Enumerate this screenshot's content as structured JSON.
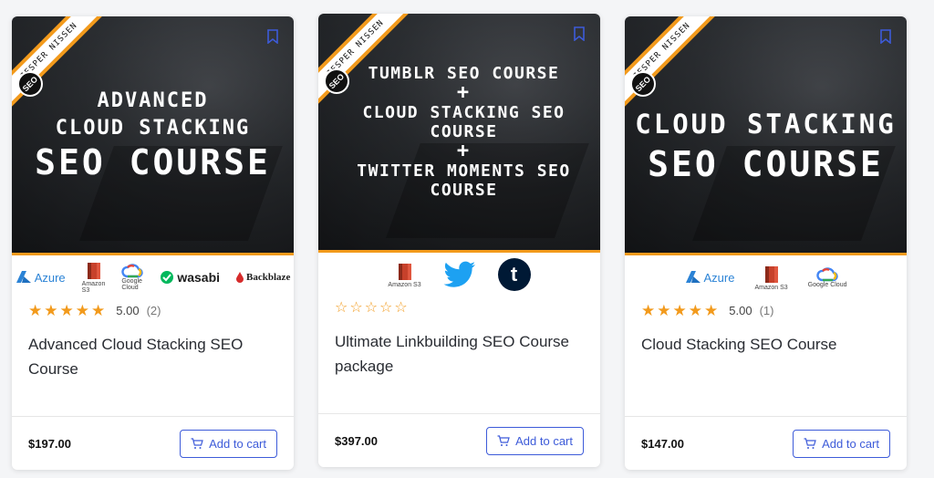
{
  "colors": {
    "accent": "#3d5bd9",
    "star": "#f29a1c",
    "ribbon": "#f29a1c"
  },
  "cards": [
    {
      "ribbon_text": "JESPER NISSEN",
      "badge": "SEO",
      "thumb_lines": [
        "ADVANCED",
        "CLOUD STACKING",
        "SEO COURSE"
      ],
      "logos": [
        "Azure",
        "Amazon S3",
        "Google Cloud",
        "wasabi",
        "Backblaze"
      ],
      "rating_score": "5.00",
      "rating_count": "(2)",
      "stars_filled": 5,
      "name": "Advanced Cloud Stacking SEO Course",
      "price": "$197.00",
      "cart_label": "Add to cart"
    },
    {
      "ribbon_text": "JESPER NISSEN",
      "badge": "SEO",
      "thumb_lines": [
        "TUMBLR SEO COURSE",
        "+",
        "CLOUD STACKING SEO COURSE",
        "+",
        "TWITTER MOMENTS SEO COURSE"
      ],
      "logos": [
        "Amazon S3",
        "twitter-icon",
        "tumblr-icon"
      ],
      "tumblr_letter": "t",
      "stars_filled": 0,
      "name": "Ultimate Linkbuilding SEO Course package",
      "price": "$397.00",
      "cart_label": "Add to cart"
    },
    {
      "ribbon_text": "JESPER NISSEN",
      "badge": "SEO",
      "thumb_lines": [
        "CLOUD STACKING",
        "SEO COURSE"
      ],
      "logos": [
        "Azure",
        "Amazon S3",
        "Google Cloud"
      ],
      "rating_score": "5.00",
      "rating_count": "(1)",
      "stars_filled": 5,
      "name": "Cloud Stacking SEO Course",
      "price": "$147.00",
      "cart_label": "Add to cart"
    }
  ]
}
